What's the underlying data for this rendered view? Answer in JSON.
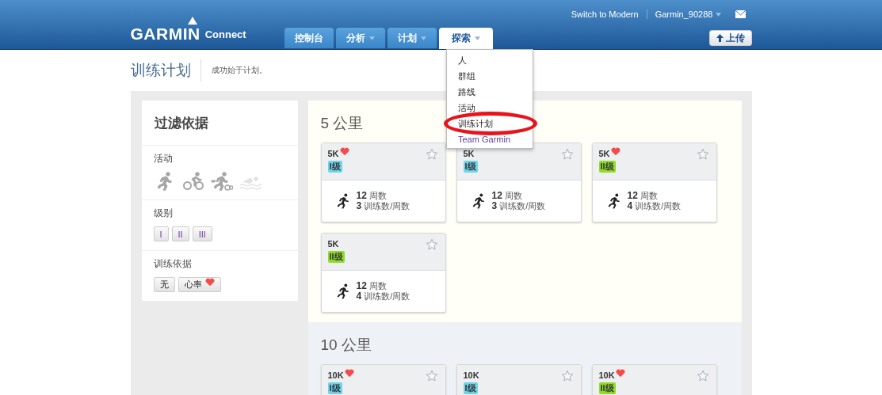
{
  "header": {
    "logo": {
      "brand": "GARMIN",
      "product": "Connect"
    },
    "switch_link": "Switch to Modern",
    "user": "Garmin_90288",
    "upload_button": "上传",
    "nav_tabs": [
      {
        "label": "控制台",
        "has_menu": false,
        "selected": false
      },
      {
        "label": "分析",
        "has_menu": true,
        "selected": false
      },
      {
        "label": "计划",
        "has_menu": true,
        "selected": false
      },
      {
        "label": "探索",
        "has_menu": true,
        "selected": true
      }
    ],
    "menu": {
      "items": [
        {
          "label": "人",
          "circled": false
        },
        {
          "label": "群组",
          "circled": false
        },
        {
          "label": "路线",
          "circled": false
        },
        {
          "label": "活动",
          "circled": false
        },
        {
          "label": "训练计划",
          "circled": true
        },
        {
          "label": "Team Garmin",
          "circled": false
        }
      ]
    }
  },
  "page": {
    "title": "训练计划",
    "subtitle": "成功始于计划。"
  },
  "sidebar": {
    "title": "过滤依据",
    "sections": [
      {
        "label": "活动",
        "kind": "icons",
        "items": [
          {
            "kind": "run",
            "disabled": false
          },
          {
            "kind": "bike",
            "disabled": false
          },
          {
            "kind": "triathlon",
            "disabled": false
          },
          {
            "kind": "swim",
            "disabled": true
          }
        ]
      },
      {
        "label": "级别",
        "kind": "buttons",
        "items": [
          {
            "label": "I"
          },
          {
            "label": "II"
          },
          {
            "label": "III"
          }
        ]
      },
      {
        "label": "训练依据",
        "kind": "buttons",
        "items": [
          {
            "label": "无",
            "heart": false
          },
          {
            "label": "心率",
            "heart": true
          }
        ]
      }
    ]
  },
  "sections": [
    {
      "title": "5 公里",
      "plans": [
        {
          "name": "5K",
          "heart_rate": true,
          "level": "I级",
          "color": "#6fd3ea",
          "weeks": "12",
          "weeks_label": "周数",
          "per_week": "3",
          "per_week_label": "训练数/周数"
        },
        {
          "name": "5K",
          "heart_rate": false,
          "level": "I级",
          "color": "#6fd3ea",
          "weeks": "12",
          "weeks_label": "周数",
          "per_week": "3",
          "per_week_label": "训练数/周数"
        },
        {
          "name": "5K",
          "heart_rate": true,
          "level": "II级",
          "color": "#8fdc2a",
          "weeks": "12",
          "weeks_label": "周数",
          "per_week": "4",
          "per_week_label": "训练数/周数"
        },
        {
          "name": "5K",
          "heart_rate": false,
          "level": "II级",
          "color": "#8fdc2a",
          "weeks": "12",
          "weeks_label": "周数",
          "per_week": "4",
          "per_week_label": "训练数/周数"
        }
      ]
    },
    {
      "title": "10 公里",
      "plans": [
        {
          "name": "10K",
          "heart_rate": true,
          "level": "I级",
          "color": "#6fd3ea"
        },
        {
          "name": "10K",
          "heart_rate": false,
          "level": "I级",
          "color": "#6fd3ea"
        },
        {
          "name": "10K",
          "heart_rate": true,
          "level": "II级",
          "color": "#8fdc2a"
        }
      ]
    }
  ]
}
